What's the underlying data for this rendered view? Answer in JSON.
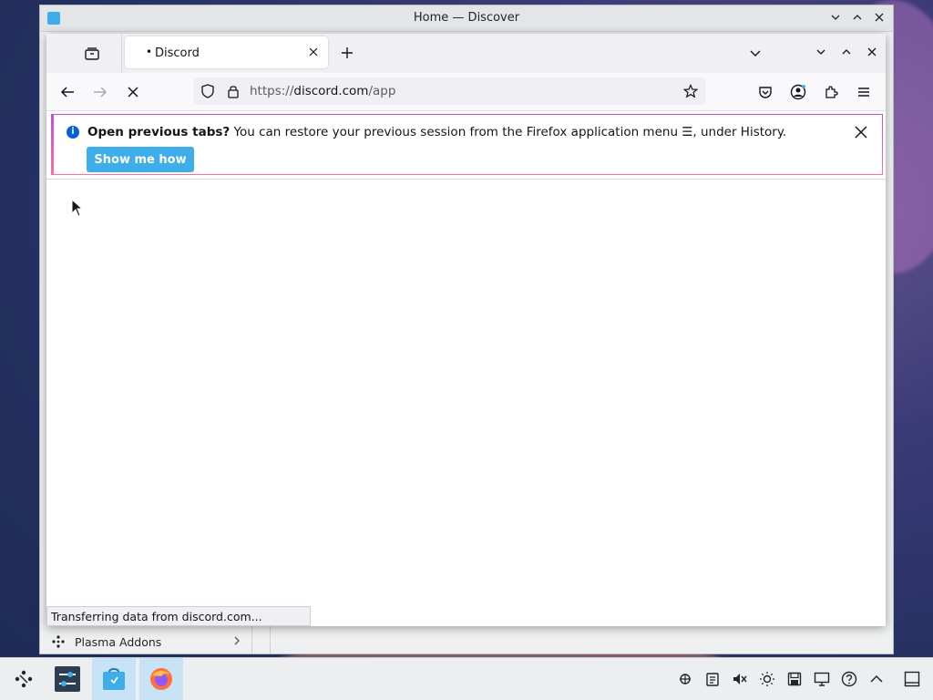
{
  "discover": {
    "title": "Home — Discover",
    "sidebar_item": "Plasma Addons"
  },
  "firefox": {
    "tab": {
      "title": "Discord",
      "loading_dot": "•"
    },
    "url": {
      "scheme": "https://",
      "host": "discord.com",
      "path": "/app"
    },
    "notification": {
      "bold": "Open previous tabs?",
      "text": " You can restore your previous session from the Firefox application menu ☰, under History.",
      "button": "Show me how"
    },
    "status": "Transferring data from discord.com..."
  },
  "icons": {
    "window_controls": [
      "minimize-icon",
      "maximize-icon",
      "close-icon"
    ],
    "navbar": [
      "back-icon",
      "forward-icon",
      "stop-icon",
      "shield-icon",
      "lock-icon",
      "bookmark-star-icon",
      "pocket-icon",
      "account-icon",
      "extensions-icon",
      "app-menu-icon"
    ],
    "taskbar": [
      "launcher-icon",
      "system-settings-icon",
      "discover-icon",
      "firefox-icon"
    ],
    "tray": [
      "network-icon",
      "clipboard-icon",
      "volume-muted-icon",
      "brightness-icon",
      "disks-icon",
      "display-icon",
      "help-icon",
      "expand-tray-icon",
      "show-desktop-icon"
    ]
  },
  "colors": {
    "accent": "#3daee9",
    "firefox_blue": "#0060df"
  }
}
